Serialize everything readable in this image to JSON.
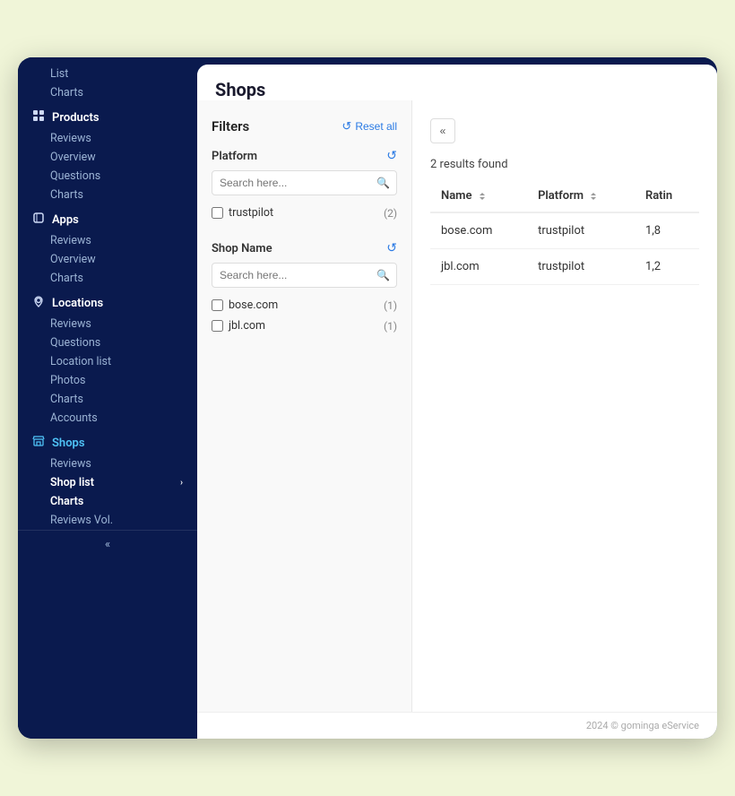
{
  "app": {
    "title": "Shops"
  },
  "sidebar": {
    "collapse_icon": "«",
    "sections": [
      {
        "id": "products",
        "label": "Products",
        "icon": "🗂",
        "items": [
          "Reviews",
          "Overview",
          "Questions",
          "Charts"
        ]
      },
      {
        "id": "apps",
        "label": "Apps",
        "icon": "📱",
        "items": [
          "Reviews",
          "Overview",
          "Charts"
        ]
      },
      {
        "id": "locations",
        "label": "Locations",
        "icon": "📍",
        "items": [
          "Reviews",
          "Questions",
          "Location list",
          "Photos",
          "Charts",
          "Accounts"
        ]
      },
      {
        "id": "shops",
        "label": "Shops",
        "icon": "🛒",
        "active": true,
        "items": [
          {
            "label": "Reviews",
            "active": false
          },
          {
            "label": "Shop list",
            "active": true,
            "arrow": true
          },
          {
            "label": "Charts",
            "active": false
          },
          {
            "label": "Reviews Vol.",
            "active": false
          }
        ]
      }
    ],
    "top_items": [
      "List",
      "Charts"
    ]
  },
  "filters": {
    "title": "Filters",
    "reset_label": "Reset all",
    "groups": [
      {
        "id": "platform",
        "label": "Platform",
        "search_placeholder": "Search here...",
        "options": [
          {
            "label": "trustpilot",
            "count": 2
          }
        ]
      },
      {
        "id": "shop_name",
        "label": "Shop Name",
        "search_placeholder": "Search here...",
        "options": [
          {
            "label": "bose.com",
            "count": 1
          },
          {
            "label": "jbl.com",
            "count": 1
          }
        ]
      }
    ]
  },
  "results": {
    "count_label": "2 results found",
    "columns": [
      "Name",
      "Platform",
      "Ratin"
    ],
    "rows": [
      {
        "name": "bose.com",
        "platform": "trustpilot",
        "rating": "1,8"
      },
      {
        "name": "jbl.com",
        "platform": "trustpilot",
        "rating": "1,2"
      }
    ]
  },
  "footer": {
    "copyright": "2024 © gominga eService"
  }
}
